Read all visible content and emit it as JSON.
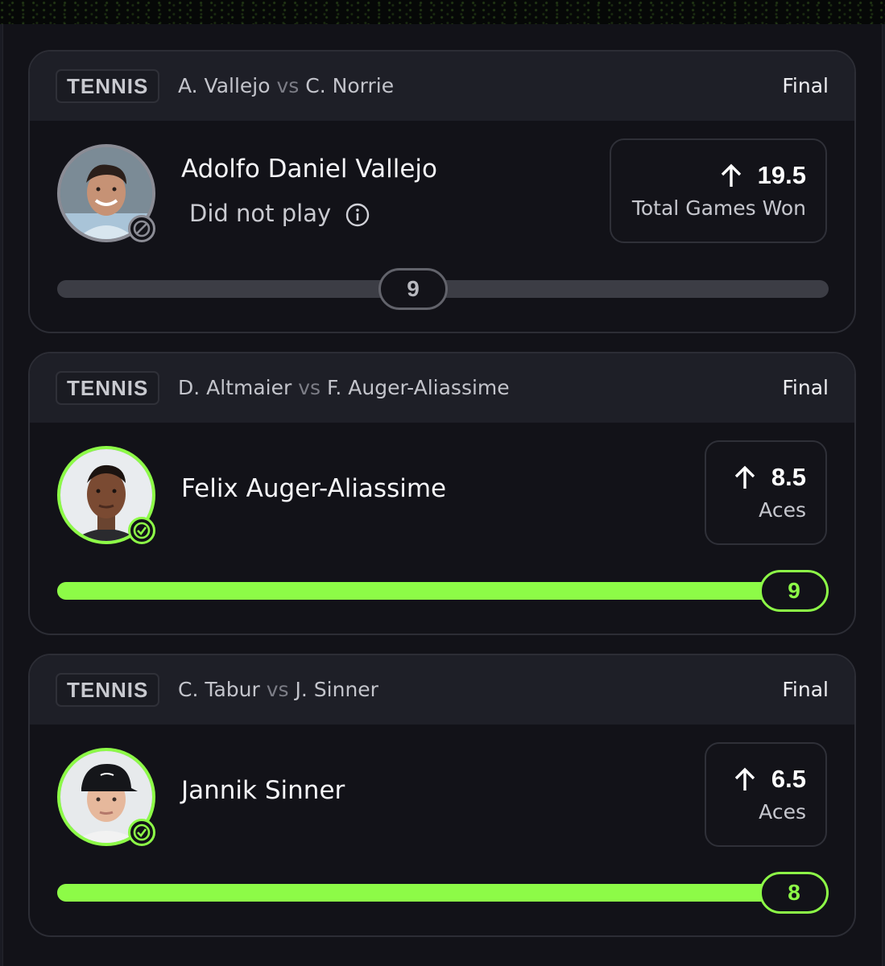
{
  "colors": {
    "accent_green": "#8dfb47",
    "neutral_ring": "#8b8c95",
    "background": "#121218",
    "header_bg": "#1e1f27"
  },
  "cards": [
    {
      "sport": "TENNIS",
      "player_a": "A. Vallejo",
      "vs": "vs",
      "player_b": "C. Norrie",
      "status": "Final",
      "player_name": "Adolfo Daniel Vallejo",
      "note": "Did not play",
      "note_icon": "info-icon",
      "avatar_state_icon": "ban-icon",
      "direction_icon": "arrow-up-icon",
      "line": "19.5",
      "stat": "Total Games Won",
      "result": "9",
      "progress_fraction": 0.46,
      "outcome": "void"
    },
    {
      "sport": "TENNIS",
      "player_a": "D. Altmaier",
      "vs": "vs",
      "player_b": "F. Auger-Aliassime",
      "status": "Final",
      "player_name": "Felix Auger-Aliassime",
      "avatar_state_icon": "check-icon",
      "direction_icon": "arrow-up-icon",
      "line": "8.5",
      "stat": "Aces",
      "result": "9",
      "progress_fraction": 1.0,
      "outcome": "win"
    },
    {
      "sport": "TENNIS",
      "player_a": "C. Tabur",
      "vs": "vs",
      "player_b": "J. Sinner",
      "status": "Final",
      "player_name": "Jannik Sinner",
      "avatar_state_icon": "check-icon",
      "direction_icon": "arrow-up-icon",
      "line": "6.5",
      "stat": "Aces",
      "result": "8",
      "progress_fraction": 1.0,
      "outcome": "win"
    }
  ]
}
